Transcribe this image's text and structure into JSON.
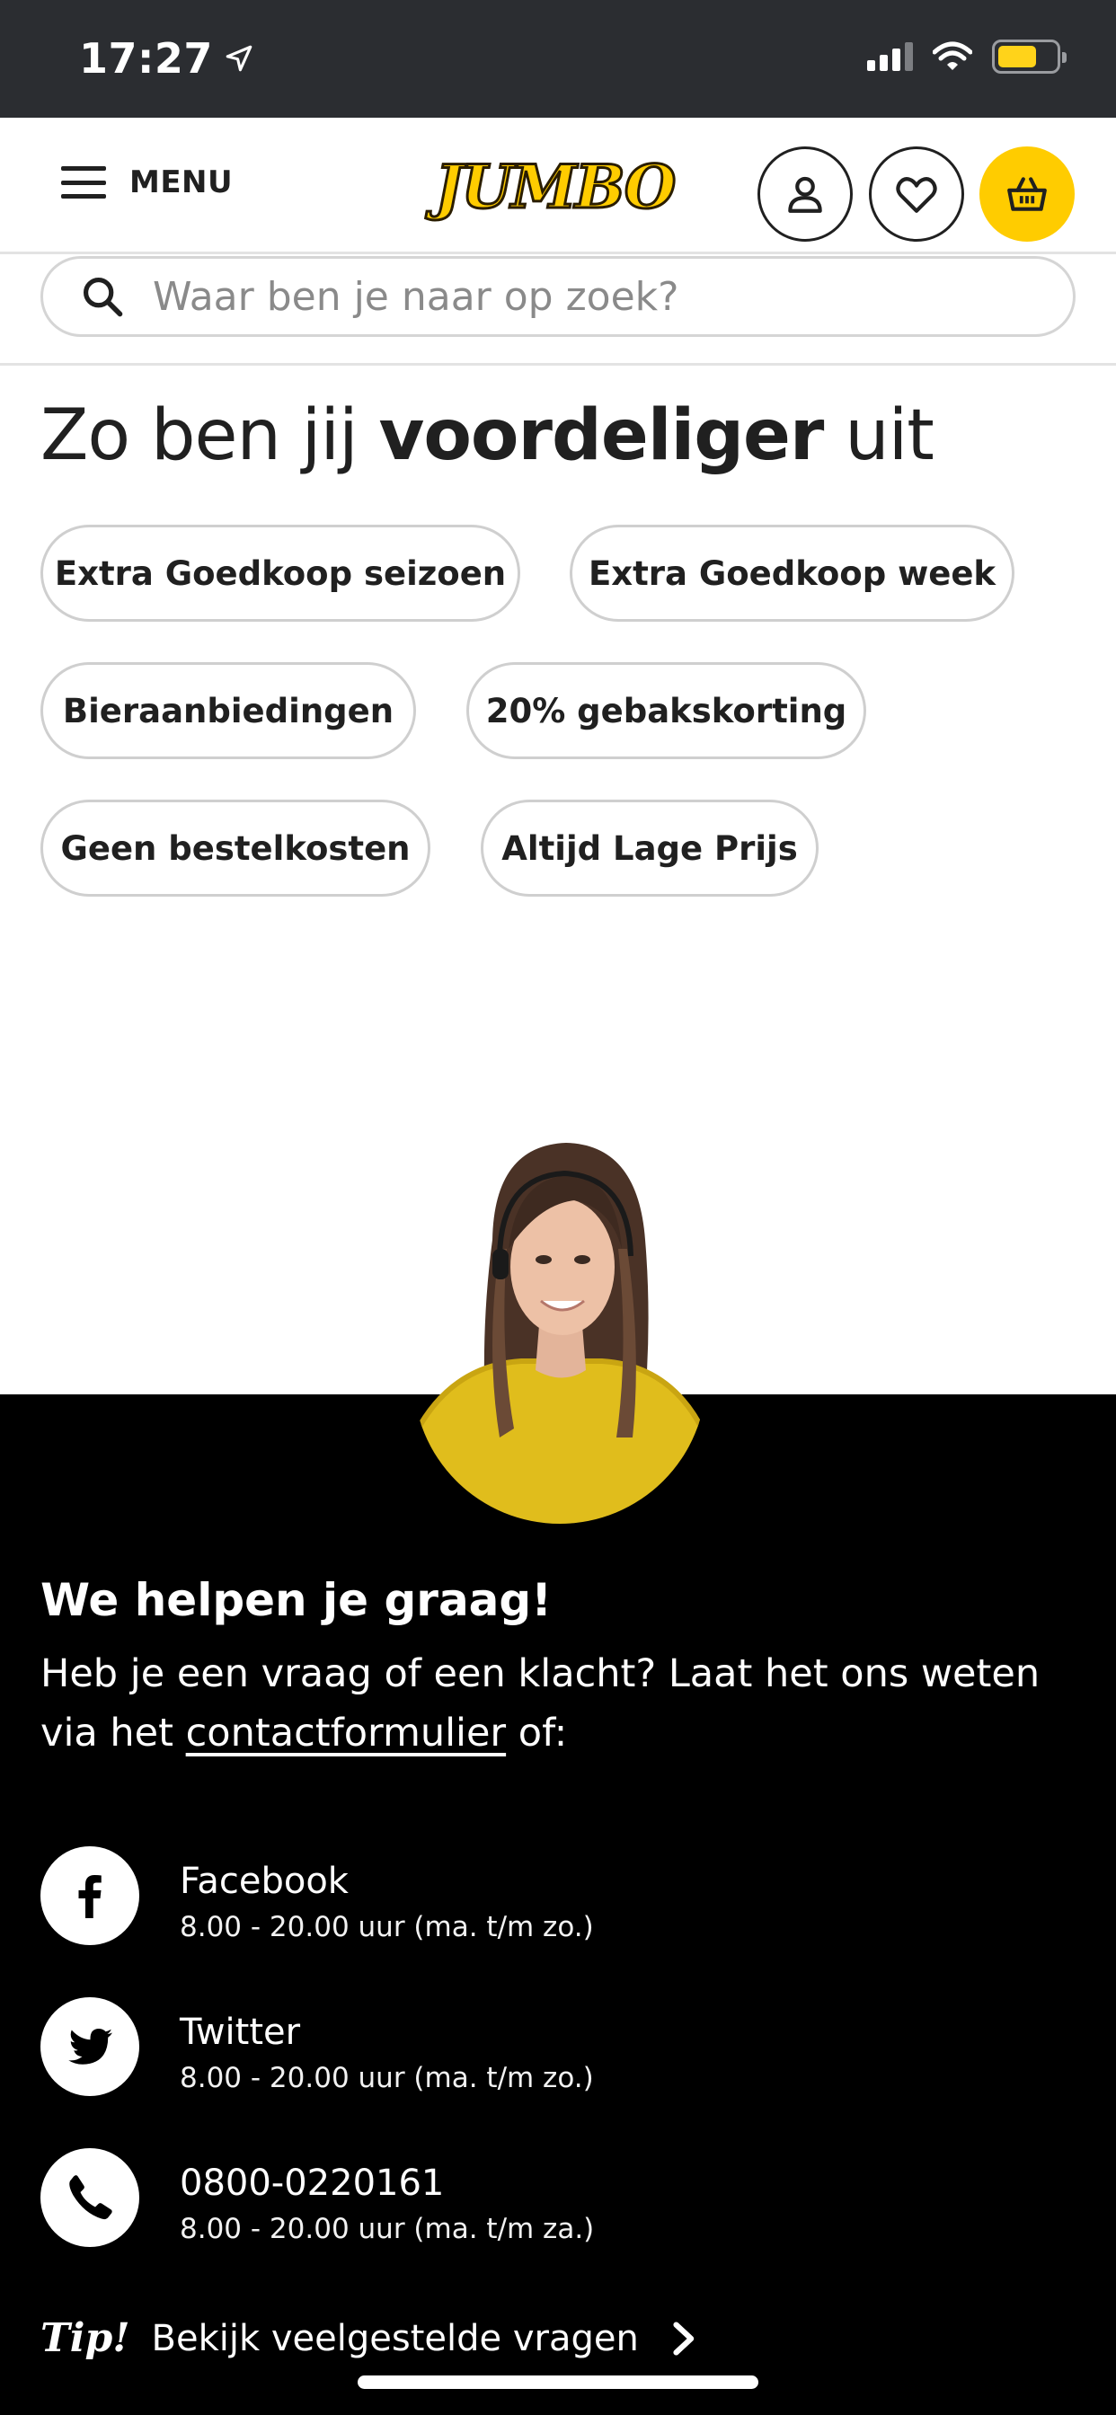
{
  "status_bar": {
    "time": "17:27"
  },
  "header": {
    "menu_label": "MENU",
    "logo_text": "JUMBO",
    "icons": [
      "account-icon",
      "heart-icon",
      "basket-icon"
    ],
    "accent_color": "#ffcc00"
  },
  "search": {
    "placeholder": "Waar ben je naar op zoek?"
  },
  "promo": {
    "title_prefix": "Zo ben jij ",
    "title_bold": "voordeliger",
    "title_suffix": " uit",
    "chips": [
      "Extra Goedkoop seizoen",
      "Extra Goedkoop week",
      "Bieraanbiedingen",
      "20% gebakskorting",
      "Geen bestelkosten",
      "Altijd Lage Prijs"
    ]
  },
  "help": {
    "title": "We helpen je graag!",
    "text_before": "Heb je een vraag of een klacht? Laat het ons weten via het ",
    "link": "contactformulier",
    "text_after": " of:",
    "contacts": [
      {
        "name": "Facebook",
        "hours": "8.00 - 20.00 uur (ma. t/m zo.)",
        "icon": "facebook-icon"
      },
      {
        "name": "Twitter",
        "hours": "8.00 - 20.00 uur (ma. t/m zo.)",
        "icon": "twitter-icon"
      },
      {
        "name": "0800-0220161",
        "hours": "8.00 - 20.00 uur (ma. t/m za.)",
        "icon": "phone-icon"
      }
    ],
    "tip_label": "Tip!",
    "tip_link": "Bekijk veelgestelde vragen"
  }
}
